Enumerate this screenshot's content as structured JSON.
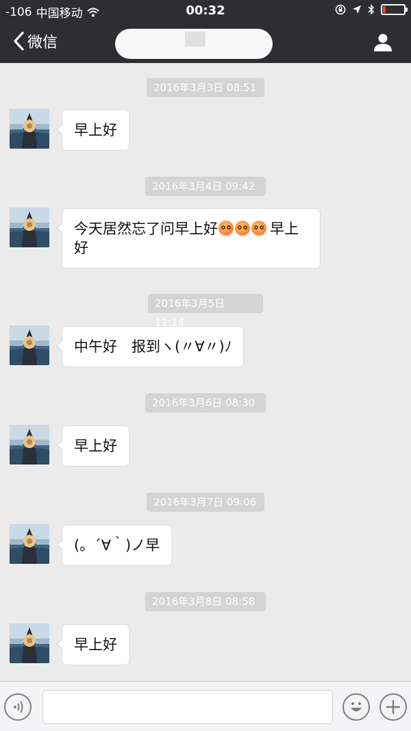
{
  "status_bar": {
    "signal": "-106",
    "carrier": "中国移动",
    "time": "00:32",
    "battery_fraction": 0.12
  },
  "nav": {
    "back_label": "微信"
  },
  "messages": [
    {
      "timestamp": "2016年3月3日 08:51",
      "text": "早上好"
    },
    {
      "timestamp": "2016年3月4日 09:42",
      "text_line1": "今天居然忘了问早上好",
      "text_after_emoji": "早上",
      "text_line2": "好",
      "emoji": [
        "flushed-face",
        "flushed-face",
        "flushed-face"
      ]
    },
    {
      "timestamp": "2016年3月5日 11:14",
      "text": "中午好　报到ヽ(〃∀〃)ﾉ"
    },
    {
      "timestamp": "2016年3月6日 08:30",
      "text": "早上好"
    },
    {
      "timestamp": "2016年3月7日 09:06",
      "text": "(。´∀｀)ノ早"
    },
    {
      "timestamp": "2016年3月8日 08:58",
      "text": "早上好"
    }
  ],
  "colors": {
    "header_bg": "#2e2e32",
    "chat_bg": "#ebebeb",
    "bubble_bg": "#ffffff",
    "timestamp_bg": "#d4d4d4",
    "battery_low": "#ff3b30"
  }
}
